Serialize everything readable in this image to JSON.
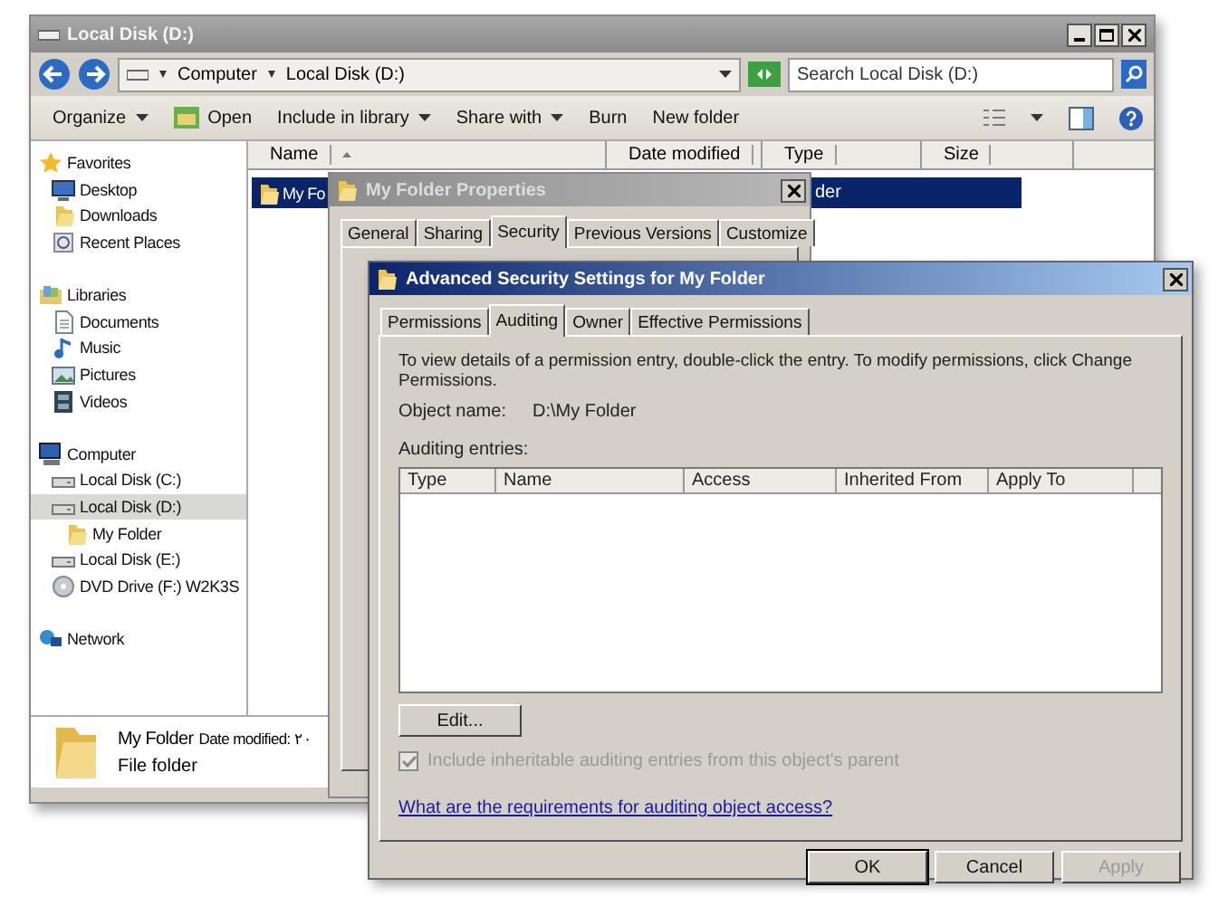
{
  "explorer": {
    "title": "Local Disk (D:)",
    "breadcrumb": [
      "Computer",
      "Local Disk (D:)"
    ],
    "search": {
      "placeholder": "Search Local Disk (D:)"
    },
    "toolbar": [
      {
        "label": "Organize",
        "dropdown": true
      },
      {
        "label": "Open",
        "dropdown": false
      },
      {
        "label": "Include in library",
        "dropdown": true
      },
      {
        "label": "Share with",
        "dropdown": true
      },
      {
        "label": "Burn",
        "dropdown": false
      },
      {
        "label": "New folder",
        "dropdown": false
      }
    ],
    "columns": [
      "Name",
      "Date modified",
      "Type",
      "Size"
    ],
    "nav": [
      {
        "label": "Favorites",
        "kind": "star",
        "selected": false,
        "children": [
          {
            "label": "Desktop",
            "kind": "desktop",
            "selected": false
          },
          {
            "label": "Downloads",
            "kind": "folder",
            "selected": false
          },
          {
            "label": "Recent Places",
            "kind": "recent",
            "selected": false
          }
        ]
      },
      {
        "label": "Libraries",
        "kind": "library",
        "selected": false,
        "children": [
          {
            "label": "Documents",
            "kind": "document",
            "selected": false
          },
          {
            "label": "Music",
            "kind": "music",
            "selected": false
          },
          {
            "label": "Pictures",
            "kind": "pictures",
            "selected": false
          },
          {
            "label": "Videos",
            "kind": "video",
            "selected": false
          }
        ]
      },
      {
        "label": "Computer",
        "kind": "computer",
        "selected": false,
        "children": [
          {
            "label": "Local Disk (C:)",
            "kind": "disk",
            "selected": false
          },
          {
            "label": "Local Disk (D:)",
            "kind": "disk",
            "selected": true,
            "children": [
              {
                "label": "My Folder",
                "kind": "folder",
                "selected": false
              }
            ]
          },
          {
            "label": "Local Disk (E:)",
            "kind": "disk",
            "selected": false
          },
          {
            "label": "DVD Drive (F:) W2K3S",
            "kind": "dvd",
            "selected": false
          }
        ]
      },
      {
        "label": "Network",
        "kind": "network",
        "selected": false
      }
    ],
    "files": [
      {
        "name_left": "My Fo",
        "name_right": "der",
        "selected": true
      }
    ],
    "details": {
      "name": "My Folder",
      "modified": "Date modified: ٢٠",
      "type": "File folder"
    }
  },
  "properties": {
    "title": "My Folder Properties",
    "tabs": [
      {
        "label": "General",
        "selected": false
      },
      {
        "label": "Sharing",
        "selected": false
      },
      {
        "label": "Security",
        "selected": true
      },
      {
        "label": "Previous Versions",
        "selected": false
      },
      {
        "label": "Customize",
        "selected": false
      }
    ]
  },
  "advanced": {
    "title": "Advanced Security Settings for My Folder",
    "tabs": [
      {
        "label": "Permissions",
        "selected": false
      },
      {
        "label": "Auditing",
        "selected": true
      },
      {
        "label": "Owner",
        "selected": false
      },
      {
        "label": "Effective Permissions",
        "selected": false
      }
    ],
    "description": "To view details of a permission entry, double-click the entry. To modify permissions, click Change Permissions.",
    "object_label": "Object name:",
    "object_value": "D:\\My Folder",
    "entries_label": "Auditing entries:",
    "columns": [
      "Type",
      "Name",
      "Access",
      "Inherited From",
      "Apply To"
    ],
    "edit_button": "Edit...",
    "checkbox": {
      "label": "Include inheritable auditing entries from this object's parent",
      "checked": true,
      "disabled": true
    },
    "link": "What are the requirements for auditing object access?",
    "buttons": [
      {
        "label": "OK",
        "disabled": false
      },
      {
        "label": "Cancel",
        "disabled": false
      },
      {
        "label": "Apply",
        "disabled": true
      }
    ]
  }
}
